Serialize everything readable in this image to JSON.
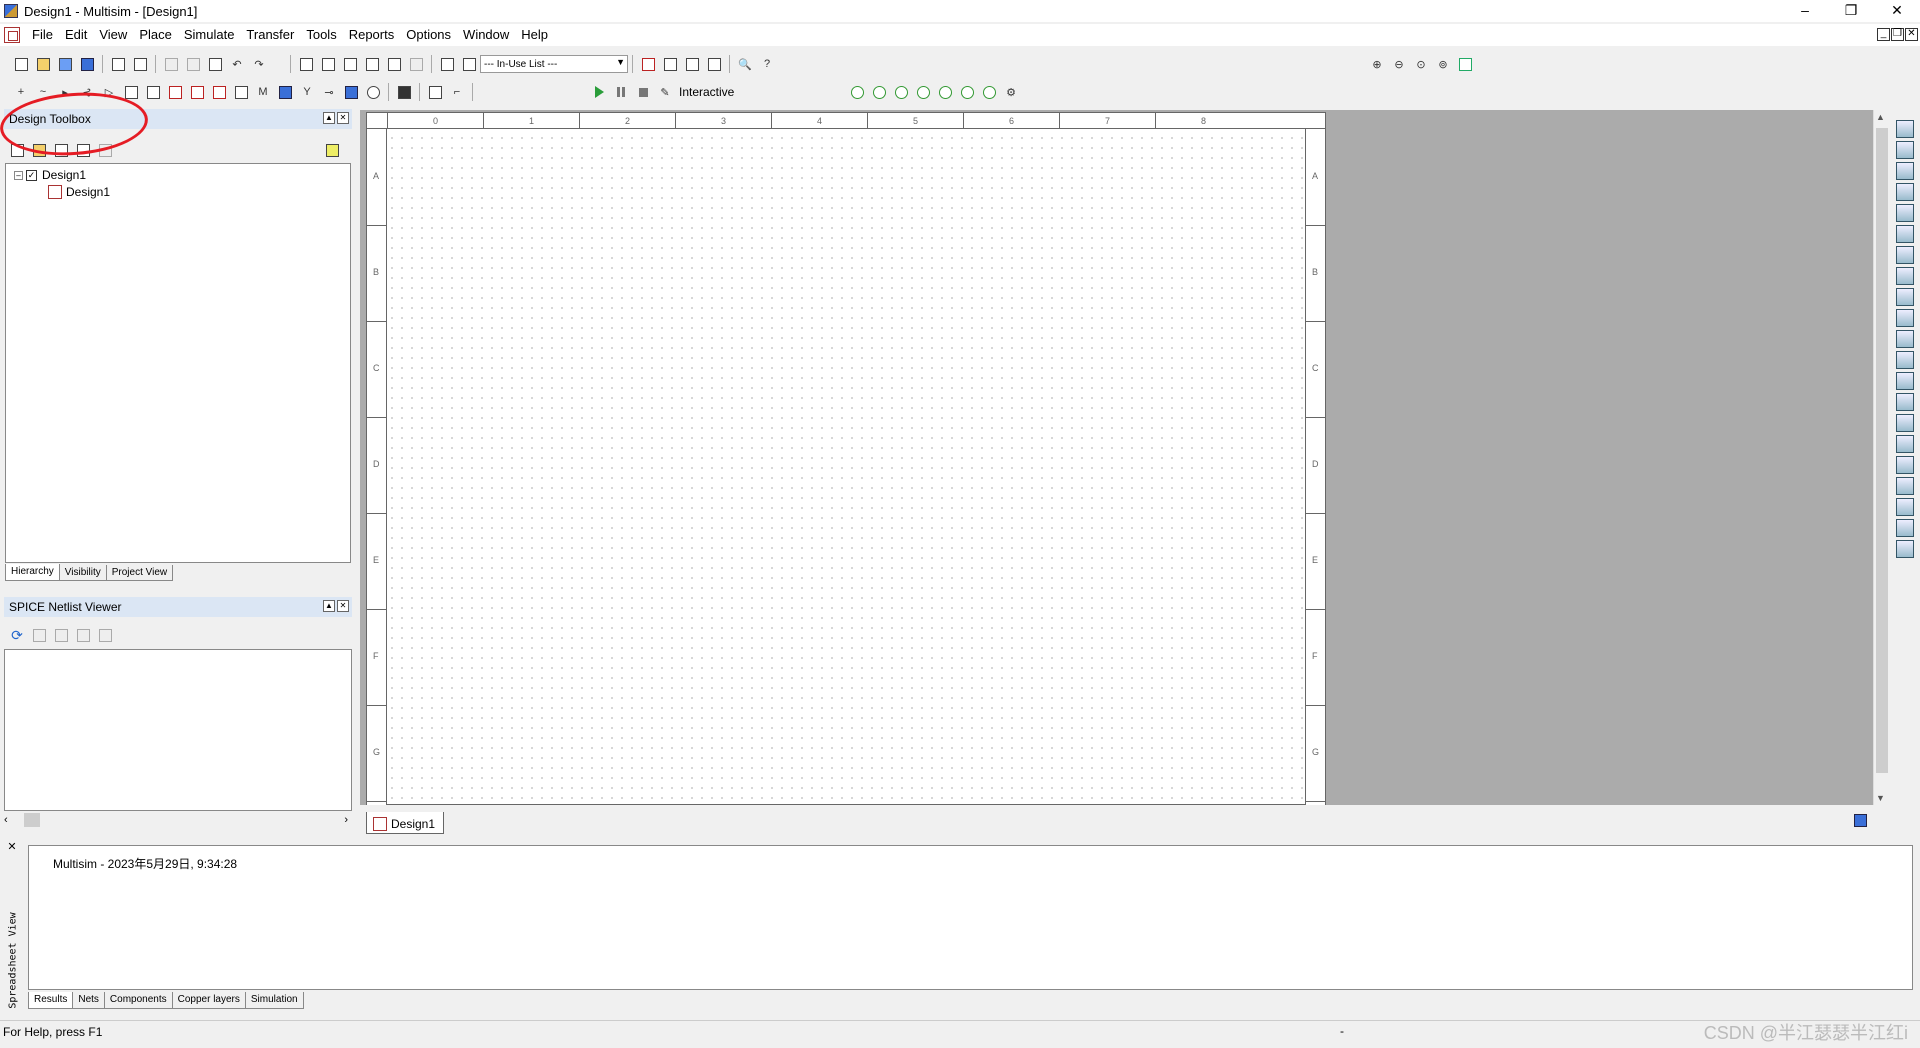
{
  "window": {
    "title": "Design1 - Multisim - [Design1]",
    "minimize": "–",
    "restore": "❐",
    "close": "✕"
  },
  "menu": [
    "File",
    "Edit",
    "View",
    "Place",
    "Simulate",
    "Transfer",
    "Tools",
    "Reports",
    "Options",
    "Window",
    "Help"
  ],
  "toolbar": {
    "in_use_list": "--- In-Use List ---",
    "interactive_label": "Interactive"
  },
  "design_toolbox": {
    "title": "Design Toolbox",
    "tree": [
      {
        "label": "Design1"
      },
      {
        "label": "Design1"
      }
    ],
    "tabs": [
      "Hierarchy",
      "Visibility",
      "Project View"
    ]
  },
  "spice_viewer": {
    "title": "SPICE Netlist Viewer"
  },
  "sheet": {
    "columns": [
      "0",
      "1",
      "2",
      "3",
      "4",
      "5",
      "6",
      "7",
      "8"
    ],
    "rows": [
      "A",
      "B",
      "C",
      "D",
      "E",
      "F",
      "G"
    ],
    "tab_label": "Design1"
  },
  "spreadsheet": {
    "side_label": "Spreadsheet View",
    "log_line": "Multisim  -  2023年5月29日, 9:34:28",
    "tabs": [
      "Results",
      "Nets",
      "Components",
      "Copper layers",
      "Simulation"
    ]
  },
  "status": {
    "help_text": "For Help, press F1",
    "dash": "-",
    "watermark": "CSDN @半江瑟瑟半江红i"
  },
  "colors": {
    "annotation": "#e51c24",
    "panel_header": "#dbe6f4",
    "workspace": "#ababab"
  }
}
